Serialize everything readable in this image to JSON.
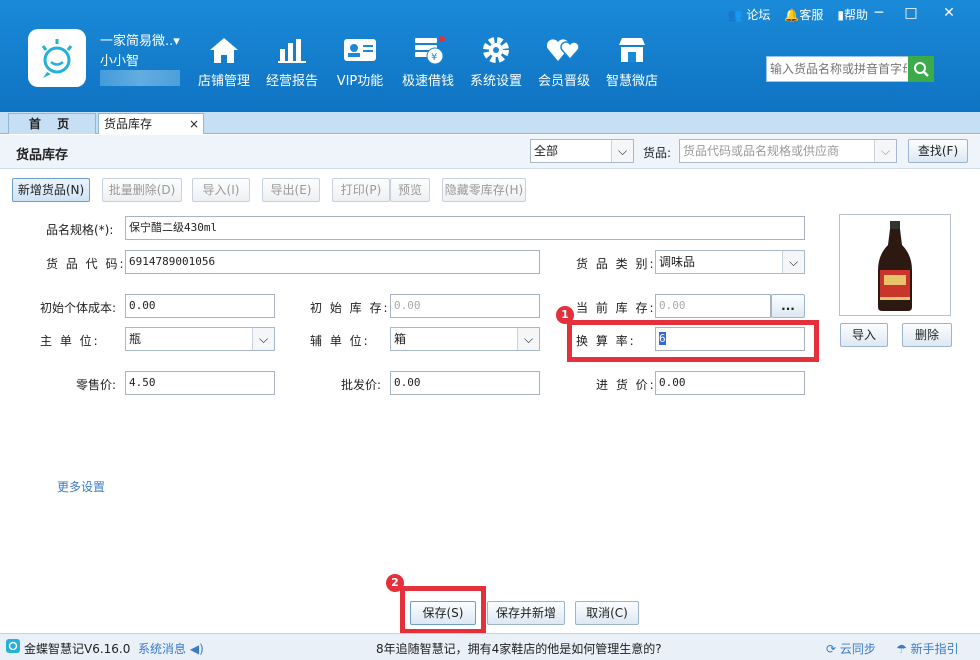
{
  "header": {
    "shop_name": "一家简易微..▾",
    "user_name": "小小智",
    "nav": [
      {
        "label": "店铺管理",
        "icon": "home-icon"
      },
      {
        "label": "经营报告",
        "icon": "bar-chart-icon"
      },
      {
        "label": "VIP功能",
        "icon": "vip-card-icon"
      },
      {
        "label": "极速借钱",
        "icon": "money-icon"
      },
      {
        "label": "系统设置",
        "icon": "gear-icon"
      },
      {
        "label": "会员晋级",
        "icon": "hearts-icon"
      },
      {
        "label": "智慧微店",
        "icon": "shop-icon"
      }
    ],
    "links": {
      "forum": "论坛",
      "service": "客服",
      "help": "帮助"
    },
    "search_placeholder": "输入货品名称或拼音首字母"
  },
  "tabs": {
    "home": "首 页",
    "stock": "货品库存",
    "close": "×"
  },
  "toolbar": {
    "title": "货品库存",
    "filter_value": "全部",
    "goods_label": "货品:",
    "goods_placeholder": "货品代码或品名规格或供应商",
    "find": "查找(F)"
  },
  "actions": {
    "new": "新增货品(N)",
    "batch_delete": "批量删除(D)",
    "import": "导入(I)",
    "export": "导出(E)",
    "print": "打印(P)",
    "preview": "预览",
    "hide_zero": "隐藏零库存(H)"
  },
  "form": {
    "name_label": "品名规格(*):",
    "name_value": "保宁醋二级430ml",
    "code_label": "货 品 代 码:",
    "code_value": "6914789001056",
    "category_label": "货 品 类 别:",
    "category_value": "调味品",
    "init_cost_label": "初始个体成本:",
    "init_cost_value": "0.00",
    "init_stock_label": "初 始 库 存:",
    "init_stock_value": "0.00",
    "current_stock_label": "当 前 库 存:",
    "current_stock_value": "0.00",
    "more_btn": "...",
    "main_unit_label": "主  单  位:",
    "main_unit_value": "瓶",
    "aux_unit_label": "辅  单  位:",
    "aux_unit_value": "箱",
    "rate_label": "换  算  率:",
    "rate_value": "6",
    "retail_label": "零售价:",
    "retail_value": "4.50",
    "wholesale_label": "批发价:",
    "wholesale_value": "0.00",
    "purchase_label": "进 货 价:",
    "purchase_value": "0.00",
    "more_settings": "更多设置"
  },
  "photo_buttons": {
    "import": "导入",
    "delete": "删除"
  },
  "bottom_buttons": {
    "save": "保存(S)",
    "save_new": "保存并新增",
    "cancel": "取消(C)"
  },
  "markers": {
    "one": "1",
    "two": "2"
  },
  "status": {
    "app": "金蝶智慧记V6.16.0",
    "messages": "系统消息",
    "ad": "8年追随智慧记，拥有4家鞋店的他是如何管理生意的?",
    "sync": "云同步",
    "guide": "新手指引"
  },
  "colors": {
    "header": "#1a8ad8",
    "highlight": "#e4303a",
    "search_button": "#3aaa4a"
  }
}
